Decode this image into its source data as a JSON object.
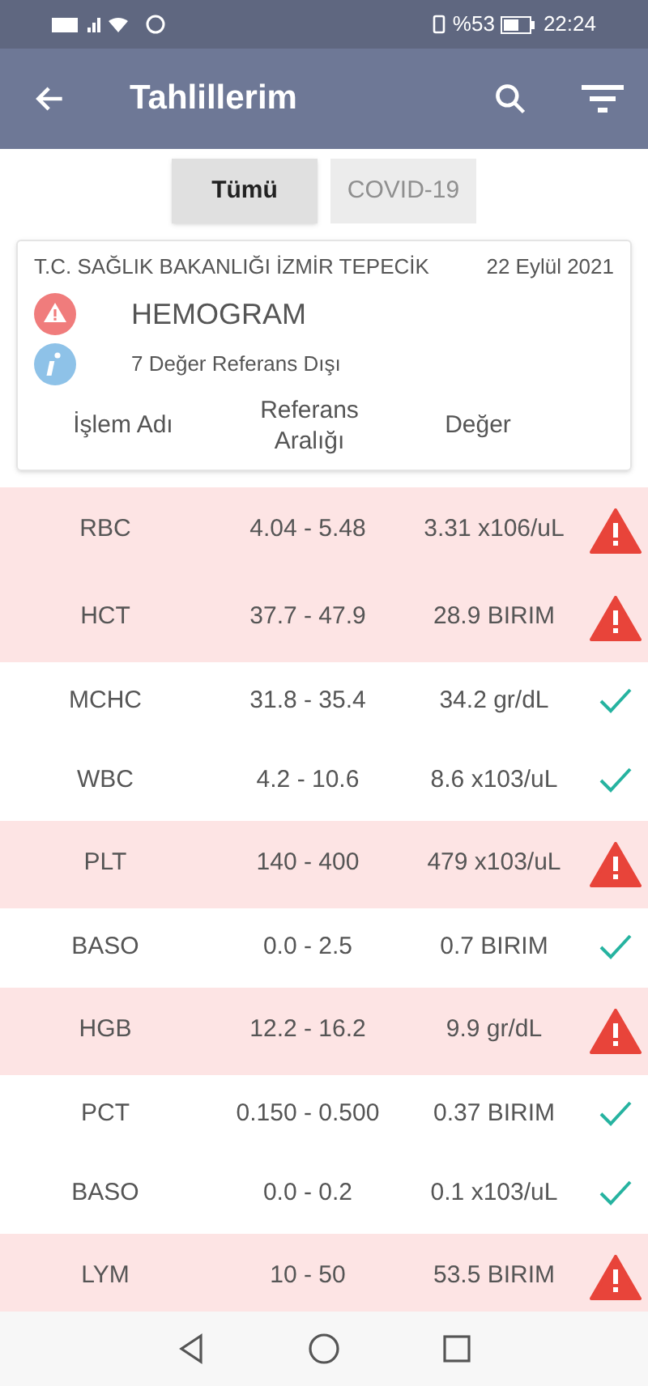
{
  "status_bar": {
    "battery": "%53",
    "time": "22:24"
  },
  "app_bar": {
    "title": "Tahlillerim"
  },
  "filters": [
    {
      "label": "Tümü",
      "selected": true
    },
    {
      "label": "COVID-19",
      "selected": false
    }
  ],
  "card": {
    "institution": "T.C. SAĞLIK BAKANLIĞI İZMİR TEPECİK",
    "date": "22 Eylül 2021",
    "test": "HEMOGRAM",
    "summary": "7 Değer Referans Dışı",
    "columns": [
      "İşlem Adı",
      "Referans Aralığı",
      "Değer"
    ]
  },
  "rows": [
    {
      "name": "RBC",
      "range": "4.04 - 5.48",
      "value": "3.31 x106/uL",
      "kind": "out"
    },
    {
      "name": "HCT",
      "range": "37.7 - 47.9",
      "value": "28.9 BIRIM",
      "kind": "out"
    },
    {
      "name": "MCHC",
      "range": "31.8 - 35.4",
      "value": "34.2 gr/dL",
      "kind": "ok"
    },
    {
      "name": "WBC",
      "range": "4.2 - 10.6",
      "value": "8.6 x103/uL",
      "kind": "ok"
    },
    {
      "name": "PLT",
      "range": "140 - 400",
      "value": "479 x103/uL",
      "kind": "out"
    },
    {
      "name": "BASO",
      "range": "0.0 - 2.5",
      "value": "0.7 BIRIM",
      "kind": "ok"
    },
    {
      "name": "HGB",
      "range": "12.2 - 16.2",
      "value": "9.9 gr/dL",
      "kind": "out"
    },
    {
      "name": "PCT",
      "range": "0.150 - 0.500",
      "value": "0.37 BIRIM",
      "kind": "ok"
    },
    {
      "name": "BASO",
      "range": "0.0 - 0.2",
      "value": "0.1 x103/uL",
      "kind": "ok"
    },
    {
      "name": "LYM",
      "range": "10 - 50",
      "value": "53.5 BIRIM",
      "kind": "out"
    }
  ]
}
